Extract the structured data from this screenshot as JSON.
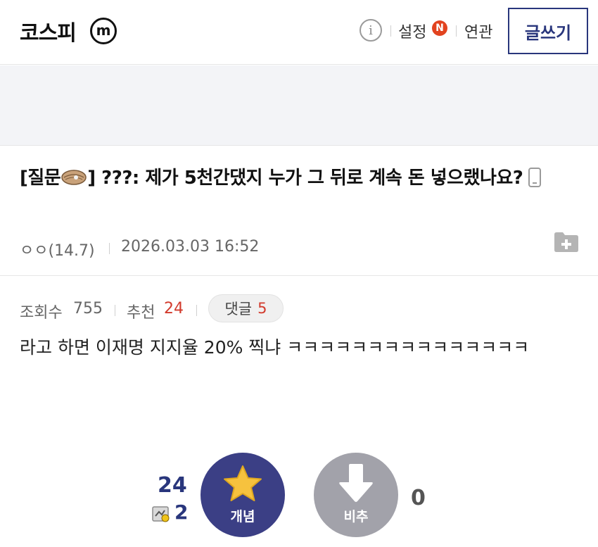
{
  "header": {
    "gallery_title": "코스피",
    "minor_badge": "m",
    "info_icon": "info-icon",
    "settings_label": "설정",
    "new_badge": "N",
    "related_label": "연관",
    "write_label": "글쓰기"
  },
  "post": {
    "title_prefix": "[질문",
    "title_bracket_close": "]",
    "title_text": " ???: 제가 5천간댔지 누가 그 뒤로 계속 돈 넣으랬나요?",
    "icons": [
      "oyster-icon",
      "mobile-icon",
      "folder-add-icon"
    ],
    "author": "ㅇㅇ(14.7)",
    "date": "2026.03.03 16:52",
    "views_label": "조회수",
    "views": "755",
    "recommend_label": "추천",
    "recommend": "24",
    "comments_label": "댓글",
    "comments": "5",
    "body": "라고 하면 이재명 지지율 20% 찍냐 ㅋㅋㅋㅋㅋㅋㅋㅋㅋㅋㅋㅋㅋㅋㅋ"
  },
  "votes": {
    "up_count": "24",
    "fixed_count": "2",
    "up_label": "개념",
    "down_label": "비추",
    "down_count": "0"
  },
  "colors": {
    "brand_navy": "#29367c",
    "upvote_bg": "#3b3f85",
    "downvote_bg": "#a2a2aa",
    "accent_red": "#d23a2c",
    "new_badge": "#e2431f"
  }
}
